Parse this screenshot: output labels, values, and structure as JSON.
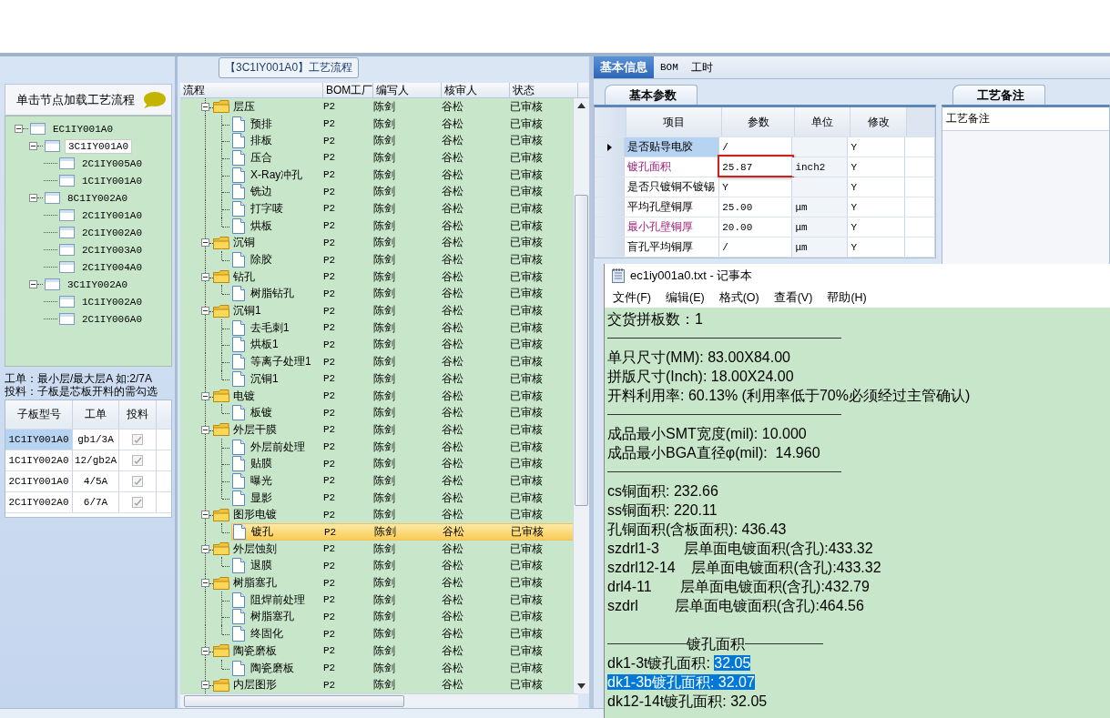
{
  "process_selector": {
    "title": "单击节点加载工艺流程",
    "tree": [
      {
        "label": "EC1IY001A0",
        "expanded": true,
        "selected": false,
        "children": [
          {
            "label": "3C1IY001A0",
            "expanded": true,
            "selected": true,
            "children": [
              {
                "label": "2C1IY005A0",
                "selected": false
              },
              {
                "label": "1C1IY001A0",
                "selected": false
              }
            ]
          },
          {
            "label": "8C1IY002A0",
            "expanded": true,
            "selected": false,
            "children": [
              {
                "label": "2C1IY001A0",
                "selected": false
              },
              {
                "label": "2C1IY002A0",
                "selected": false
              },
              {
                "label": "2C1IY003A0",
                "selected": false
              },
              {
                "label": "2C1IY004A0",
                "selected": false
              }
            ]
          },
          {
            "label": "3C1IY002A0",
            "expanded": true,
            "selected": false,
            "children": [
              {
                "label": "1C1IY002A0",
                "selected": false
              },
              {
                "label": "2C1IY006A0",
                "selected": false
              }
            ]
          }
        ]
      }
    ]
  },
  "notes": [
    "工单：最小层/最大层A 如:2/7A",
    "投料：子板是芯板开料的需勾选"
  ],
  "subboard_table": {
    "columns": [
      "子板型号",
      "工单",
      "投料"
    ],
    "rows": [
      {
        "model": "1C1IY001A0",
        "work_order": "gb1/3A",
        "checked": true,
        "selected": true
      },
      {
        "model": "1C1IY002A0",
        "work_order": "12/gb2A",
        "checked": true,
        "selected": false
      },
      {
        "model": "2C1IY001A0",
        "work_order": "4/5A",
        "checked": true,
        "selected": false
      },
      {
        "model": "2C1IY002A0",
        "work_order": "6/7A",
        "checked": true,
        "selected": false
      }
    ]
  },
  "process_flow": {
    "title": "【3C1IY001A0】工艺流程",
    "columns": [
      "流程",
      "BOM工厂",
      "编写人",
      "核审人",
      "状态"
    ],
    "items": [
      {
        "name": "层压",
        "bom": "P2",
        "writer": "陈剑",
        "reviewer": "谷松",
        "status": "已审核",
        "expanded": true,
        "selected": false,
        "children": [
          {
            "name": "预排",
            "bom": "P2",
            "writer": "陈剑",
            "reviewer": "谷松",
            "status": "已审核",
            "selected": false
          },
          {
            "name": "排板",
            "bom": "P2",
            "writer": "陈剑",
            "reviewer": "谷松",
            "status": "已审核",
            "selected": false
          },
          {
            "name": "压合",
            "bom": "P2",
            "writer": "陈剑",
            "reviewer": "谷松",
            "status": "已审核",
            "selected": false
          },
          {
            "name": "X-Ray冲孔",
            "bom": "P2",
            "writer": "陈剑",
            "reviewer": "谷松",
            "status": "已审核",
            "selected": false
          },
          {
            "name": "铣边",
            "bom": "P2",
            "writer": "陈剑",
            "reviewer": "谷松",
            "status": "已审核",
            "selected": false
          },
          {
            "name": "打字唛",
            "bom": "P2",
            "writer": "陈剑",
            "reviewer": "谷松",
            "status": "已审核",
            "selected": false
          },
          {
            "name": "烘板",
            "bom": "P2",
            "writer": "陈剑",
            "reviewer": "谷松",
            "status": "已审核",
            "selected": false
          }
        ]
      },
      {
        "name": "沉铜",
        "bom": "P2",
        "writer": "陈剑",
        "reviewer": "谷松",
        "status": "已审核",
        "expanded": true,
        "selected": false,
        "children": [
          {
            "name": "除胶",
            "bom": "P2",
            "writer": "陈剑",
            "reviewer": "谷松",
            "status": "已审核",
            "selected": false
          }
        ]
      },
      {
        "name": "钻孔",
        "bom": "P2",
        "writer": "陈剑",
        "reviewer": "谷松",
        "status": "已审核",
        "expanded": true,
        "selected": false,
        "children": [
          {
            "name": "树脂钻孔",
            "bom": "P2",
            "writer": "陈剑",
            "reviewer": "谷松",
            "status": "已审核",
            "selected": false
          }
        ]
      },
      {
        "name": "沉铜1",
        "bom": "P2",
        "writer": "陈剑",
        "reviewer": "谷松",
        "status": "已审核",
        "expanded": true,
        "selected": false,
        "children": [
          {
            "name": "去毛刺1",
            "bom": "P2",
            "writer": "陈剑",
            "reviewer": "谷松",
            "status": "已审核",
            "selected": false
          },
          {
            "name": "烘板1",
            "bom": "P2",
            "writer": "陈剑",
            "reviewer": "谷松",
            "status": "已审核",
            "selected": false
          },
          {
            "name": "等离子处理1",
            "bom": "P2",
            "writer": "陈剑",
            "reviewer": "谷松",
            "status": "已审核",
            "selected": false
          },
          {
            "name": "沉铜1",
            "bom": "P2",
            "writer": "陈剑",
            "reviewer": "谷松",
            "status": "已审核",
            "selected": false
          }
        ]
      },
      {
        "name": "电镀",
        "bom": "P2",
        "writer": "陈剑",
        "reviewer": "谷松",
        "status": "已审核",
        "expanded": true,
        "selected": false,
        "children": [
          {
            "name": "板镀",
            "bom": "P2",
            "writer": "陈剑",
            "reviewer": "谷松",
            "status": "已审核",
            "selected": false
          }
        ]
      },
      {
        "name": "外层干膜",
        "bom": "P2",
        "writer": "陈剑",
        "reviewer": "谷松",
        "status": "已审核",
        "expanded": true,
        "selected": false,
        "children": [
          {
            "name": "外层前处理",
            "bom": "P2",
            "writer": "陈剑",
            "reviewer": "谷松",
            "status": "已审核",
            "selected": false
          },
          {
            "name": "贴膜",
            "bom": "P2",
            "writer": "陈剑",
            "reviewer": "谷松",
            "status": "已审核",
            "selected": false
          },
          {
            "name": "曝光",
            "bom": "P2",
            "writer": "陈剑",
            "reviewer": "谷松",
            "status": "已审核",
            "selected": false
          },
          {
            "name": "显影",
            "bom": "P2",
            "writer": "陈剑",
            "reviewer": "谷松",
            "status": "已审核",
            "selected": false
          }
        ]
      },
      {
        "name": "图形电镀",
        "bom": "P2",
        "writer": "陈剑",
        "reviewer": "谷松",
        "status": "已审核",
        "expanded": true,
        "selected": false,
        "children": [
          {
            "name": "镀孔",
            "bom": "P2",
            "writer": "陈剑",
            "reviewer": "谷松",
            "status": "已审核",
            "selected": true
          }
        ]
      },
      {
        "name": "外层蚀刻",
        "bom": "P2",
        "writer": "陈剑",
        "reviewer": "谷松",
        "status": "已审核",
        "expanded": true,
        "selected": false,
        "children": [
          {
            "name": "退膜",
            "bom": "P2",
            "writer": "陈剑",
            "reviewer": "谷松",
            "status": "已审核",
            "selected": false
          }
        ]
      },
      {
        "name": "树脂塞孔",
        "bom": "P2",
        "writer": "陈剑",
        "reviewer": "谷松",
        "status": "已审核",
        "expanded": true,
        "selected": false,
        "children": [
          {
            "name": "阻焊前处理",
            "bom": "P2",
            "writer": "陈剑",
            "reviewer": "谷松",
            "status": "已审核",
            "selected": false
          },
          {
            "name": "树脂塞孔",
            "bom": "P2",
            "writer": "陈剑",
            "reviewer": "谷松",
            "status": "已审核",
            "selected": false
          },
          {
            "name": "终固化",
            "bom": "P2",
            "writer": "陈剑",
            "reviewer": "谷松",
            "status": "已审核",
            "selected": false
          }
        ]
      },
      {
        "name": "陶瓷磨板",
        "bom": "P2",
        "writer": "陈剑",
        "reviewer": "谷松",
        "status": "已审核",
        "expanded": true,
        "selected": false,
        "children": [
          {
            "name": "陶瓷磨板",
            "bom": "P2",
            "writer": "陈剑",
            "reviewer": "谷松",
            "status": "已审核",
            "selected": false
          }
        ]
      },
      {
        "name": "内层图形",
        "bom": "P2",
        "writer": "陈剑",
        "reviewer": "谷松",
        "status": "已审核",
        "expanded": true,
        "selected": false
      }
    ]
  },
  "detail_tabs": [
    {
      "label": "基本信息",
      "selected": true
    },
    {
      "label": "BOM",
      "selected": false
    },
    {
      "label": "工时",
      "selected": false
    }
  ],
  "basic_params": {
    "tab": "基本参数",
    "columns": [
      "项目",
      "参数",
      "单位",
      "修改"
    ],
    "rows": [
      {
        "item": "是否贴导电胶",
        "value": "/",
        "unit": "",
        "modified": "Y",
        "current": true,
        "highlighted": false,
        "outlined": false
      },
      {
        "item": "镀孔面积",
        "value": "25.87",
        "unit": "inch2",
        "modified": "Y",
        "current": false,
        "highlighted": true,
        "outlined": true
      },
      {
        "item": "是否只镀铜不镀锡",
        "value": "Y",
        "unit": "",
        "modified": "Y",
        "current": false,
        "highlighted": false,
        "outlined": false
      },
      {
        "item": "平均孔壁铜厚",
        "value": "25.00",
        "unit": "μm",
        "modified": "Y",
        "current": false,
        "highlighted": false,
        "outlined": false
      },
      {
        "item": "最小孔壁铜厚",
        "value": "20.00",
        "unit": "μm",
        "modified": "Y",
        "current": false,
        "highlighted": true,
        "outlined": false
      },
      {
        "item": "盲孔平均铜厚",
        "value": "/",
        "unit": "μm",
        "modified": "Y",
        "current": false,
        "highlighted": false,
        "outlined": false
      }
    ]
  },
  "remarks": {
    "tab": "工艺备注",
    "label": "工艺备注"
  },
  "notepad": {
    "title": "ec1iy001a0.txt - 记事本",
    "menu": [
      "文件(F)",
      "编辑(E)",
      "格式(O)",
      "查看(V)",
      "帮助(H)"
    ],
    "lines": [
      {
        "kind": "text",
        "parts": [
          {
            "text": "交货拼板数：1",
            "selected": false
          }
        ]
      },
      {
        "kind": "rule"
      },
      {
        "kind": "text",
        "parts": [
          {
            "text": "单只尺寸(MM): 83.00X84.00",
            "selected": false
          }
        ]
      },
      {
        "kind": "text",
        "parts": [
          {
            "text": "拼版尺寸(Inch): 18.00X24.00",
            "selected": false
          }
        ]
      },
      {
        "kind": "text",
        "parts": [
          {
            "text": "开料利用率: 60.13% (利用率低于70%必须经过主管确认)",
            "selected": false
          }
        ]
      },
      {
        "kind": "rule"
      },
      {
        "kind": "text",
        "parts": [
          {
            "text": "成品最小SMT宽度(mil): 10.000",
            "selected": false
          }
        ]
      },
      {
        "kind": "text",
        "parts": [
          {
            "text": "成品最小BGA直径φ(mil):  14.960",
            "selected": false
          }
        ]
      },
      {
        "kind": "rule"
      },
      {
        "kind": "text",
        "parts": [
          {
            "text": "cs铜面积: 232.66",
            "selected": false
          }
        ]
      },
      {
        "kind": "text",
        "parts": [
          {
            "text": "ss铜面积: 220.11",
            "selected": false
          }
        ]
      },
      {
        "kind": "text",
        "parts": [
          {
            "text": "孔铜面积(含板面积): 436.43",
            "selected": false
          }
        ]
      },
      {
        "kind": "text",
        "parts": [
          {
            "text": "szdrl1-3      层单面电镀面积(含孔):433.32",
            "selected": false
          }
        ]
      },
      {
        "kind": "text",
        "parts": [
          {
            "text": "szdrl12-14    层单面电镀面积(含孔):433.32",
            "selected": false
          }
        ]
      },
      {
        "kind": "text",
        "parts": [
          {
            "text": "drl4-11       层单面电镀面积(含孔):432.79",
            "selected": false
          }
        ]
      },
      {
        "kind": "text",
        "parts": [
          {
            "text": "szdrl         层单面电镀面积(含孔):464.56",
            "selected": false
          }
        ]
      },
      {
        "kind": "blank"
      },
      {
        "kind": "heading",
        "text": "镀孔面积"
      },
      {
        "kind": "text",
        "parts": [
          {
            "text": "dk1-3t镀孔面积: ",
            "selected": false
          },
          {
            "text": "32.05",
            "selected": true
          }
        ]
      },
      {
        "kind": "text",
        "parts": [
          {
            "text": "dk1-3b镀孔面积: 32.07",
            "selected": true
          }
        ]
      },
      {
        "kind": "text",
        "parts": [
          {
            "text": "dk12-14t镀孔面积: 32.05",
            "selected": false
          }
        ]
      }
    ]
  }
}
